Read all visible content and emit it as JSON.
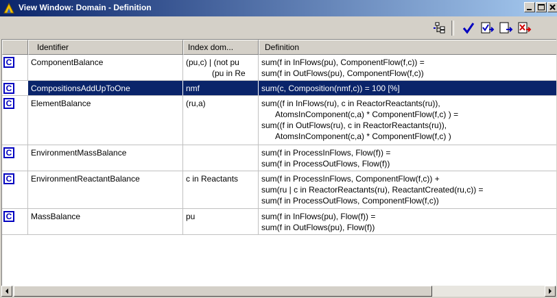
{
  "window": {
    "title": "View Window: Domain - Definition"
  },
  "columns": {
    "identifier": "Identifier",
    "index_domain": "Index dom...",
    "definition": "Definition"
  },
  "rows": [
    {
      "identifier": "ComponentBalance",
      "index": [
        "(pu,c) | (not pu",
        "(pu in Re"
      ],
      "definition": [
        "sum(f in InFlows(pu),  ComponentFlow(f,c)) =",
        "sum(f in OutFlows(pu), ComponentFlow(f,c))"
      ]
    },
    {
      "identifier": "CompositionsAddUpToOne",
      "index": [
        "nmf"
      ],
      "definition": [
        "sum(c, Composition(nmf,c)) = 100 [%]"
      ]
    },
    {
      "identifier": "ElementBalance",
      "index": [
        "(ru,a)"
      ],
      "definition": [
        "sum((f in InFlows(ru), c in ReactorReactants(ru)),",
        "AtomsInComponent(c,a) * ComponentFlow(f,c)    ) =",
        "sum((f in OutFlows(ru), c in ReactorReactants(ru)),",
        "AtomsInComponent(c,a) * ComponentFlow(f,c)    )"
      ]
    },
    {
      "identifier": "EnvironmentMassBalance",
      "index": [
        ""
      ],
      "definition": [
        "sum(f in ProcessInFlows, Flow(f)) =",
        "sum(f in ProcessOutFlows, Flow(f))"
      ]
    },
    {
      "identifier": "EnvironmentReactantBalance",
      "index": [
        "c in Reactants"
      ],
      "definition": [
        "sum(f in ProcessInFlows, ComponentFlow(f,c))           +",
        "sum(ru | c in ReactorReactants(ru), ReactantCreated(ru,c)) =",
        "sum(f in ProcessOutFlows, ComponentFlow(f,c))"
      ]
    },
    {
      "identifier": "MassBalance",
      "index": [
        "pu"
      ],
      "definition": [
        "sum(f in InFlows(pu), Flow(f)) =",
        "sum(f in OutFlows(pu), Flow(f))"
      ]
    }
  ],
  "row_icon_letter": "C",
  "colors": {
    "selection": "#0a246a",
    "constraint_icon": "#0000c0"
  }
}
